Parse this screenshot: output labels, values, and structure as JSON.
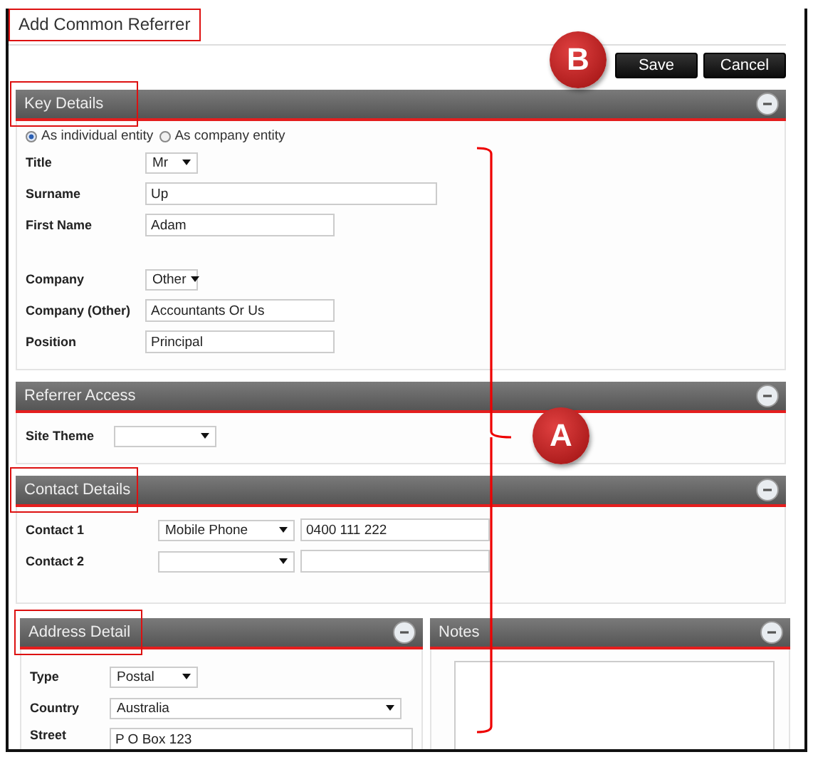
{
  "title": "Add Common Referrer",
  "buttons": [
    {
      "label": "Save"
    },
    {
      "label": "Cancel"
    }
  ],
  "callouts": [
    {
      "label": "B"
    },
    {
      "label": "A"
    }
  ],
  "sections": [
    {
      "title": "Key Details",
      "radios": [
        {
          "label": "As individual entity",
          "selected": true
        },
        {
          "label": "As company entity",
          "selected": false
        }
      ],
      "groups": [
        [
          {
            "label": "Title",
            "controls": [
              {
                "kind": "select",
                "value": "Mr"
              }
            ]
          },
          {
            "label": "Surname",
            "controls": [
              {
                "kind": "text",
                "value": "Up"
              }
            ]
          },
          {
            "label": "First Name",
            "controls": [
              {
                "kind": "text",
                "value": "Adam"
              }
            ]
          }
        ],
        [
          {
            "label": "Company",
            "controls": [
              {
                "kind": "select",
                "value": "Other"
              }
            ]
          },
          {
            "label": "Company (Other)",
            "controls": [
              {
                "kind": "text",
                "value": "Accountants Or Us"
              }
            ]
          },
          {
            "label": "Position",
            "controls": [
              {
                "kind": "text",
                "value": "Principal"
              }
            ]
          }
        ]
      ]
    },
    {
      "title": "Referrer Access",
      "groups": [
        [
          {
            "label": "Site Theme",
            "controls": [
              {
                "kind": "select"
              }
            ]
          }
        ]
      ]
    },
    {
      "title": "Contact Details",
      "groups": [
        [
          {
            "label": "Contact 1",
            "controls": [
              {
                "kind": "select",
                "value": "Mobile Phone"
              },
              {
                "kind": "text",
                "value": "0400 111 222"
              }
            ]
          },
          {
            "label": "Contact 2",
            "controls": [
              {
                "kind": "select"
              },
              {
                "kind": "text"
              }
            ]
          }
        ]
      ]
    }
  ],
  "columns": [
    {
      "title": "Address Detail",
      "kind": "form",
      "groups": [
        [
          {
            "label": "Type",
            "controls": [
              {
                "kind": "select",
                "value": "Postal"
              }
            ]
          },
          {
            "label": "Country",
            "controls": [
              {
                "kind": "select",
                "value": "Australia"
              }
            ]
          },
          {
            "label": "Street",
            "controls": [
              {
                "kind": "textarea",
                "value": "P O Box 123"
              }
            ]
          }
        ]
      ]
    },
    {
      "title": "Notes",
      "kind": "notes"
    }
  ]
}
